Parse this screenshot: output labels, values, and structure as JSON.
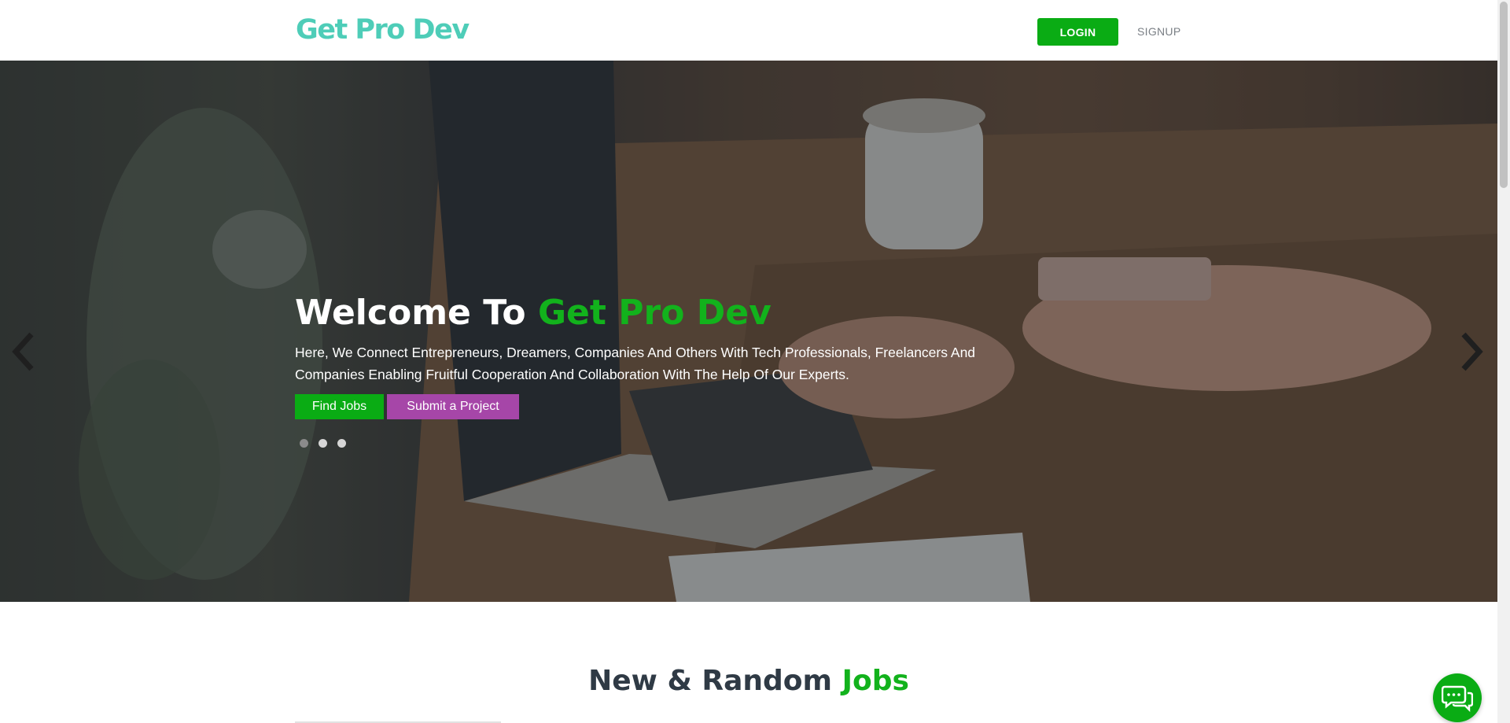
{
  "header": {
    "logo": "Get Pro Dev",
    "login_label": "LOGIN",
    "signup_label": "SIGNUP"
  },
  "hero": {
    "title_prefix": "Welcome To ",
    "title_accent": "Get Pro Dev",
    "description": "Here, We Connect Entrepreneurs, Dreamers, Companies And Others With Tech Professionals, Freelancers And Companies Enabling Fruitful Cooperation And Collaboration With The Help Of Our Experts.",
    "find_jobs_label": "Find Jobs",
    "submit_project_label": "Submit a Project",
    "slide_count": 3,
    "active_slide": 1
  },
  "section": {
    "title_prefix": "New & Random ",
    "title_accent": "Jobs"
  },
  "icons": {
    "prev": "chevron-left-icon",
    "next": "chevron-right-icon",
    "chat": "chat-bubbles-icon"
  },
  "colors": {
    "brand_teal": "#4ecdb8",
    "primary_green": "#0aac14",
    "accent_green": "#12b21c",
    "submit_purple": "#a646a8",
    "heading_dark": "#2f3a45"
  }
}
